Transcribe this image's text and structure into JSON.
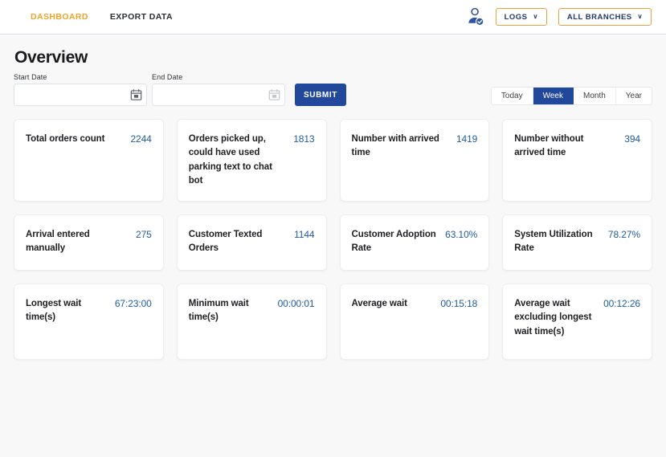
{
  "topbar": {
    "nav": [
      {
        "label": "DASHBOARD",
        "active": true
      },
      {
        "label": "EXPORT DATA",
        "active": false
      }
    ],
    "user_icon": "verified-user-icon",
    "logs_button": "LOGS",
    "branches_button": "ALL BRANCHES",
    "caret": "∨"
  },
  "overview": {
    "title": "Overview",
    "start_date_label": "Start Date",
    "end_date_label": "End Date",
    "start_date_value": "",
    "end_date_value": "",
    "start_date_placeholder": "",
    "end_date_placeholder": "",
    "submit_label": "SUBMIT",
    "calendar_icon": "calendar-icon"
  },
  "period": {
    "options": [
      {
        "label": "Today",
        "active": false
      },
      {
        "label": "Week",
        "active": true
      },
      {
        "label": "Month",
        "active": false
      },
      {
        "label": "Year",
        "active": false
      }
    ]
  },
  "cards": [
    {
      "label": "Total orders count",
      "value": "2244"
    },
    {
      "label": "Orders picked up, could have used parking text to chat bot",
      "value": "1813"
    },
    {
      "label": "Number with arrived time",
      "value": "1419"
    },
    {
      "label": "Number without arrived time",
      "value": "394"
    },
    {
      "label": "Arrival entered manually",
      "value": "275"
    },
    {
      "label": "Customer Texted Orders",
      "value": "1144"
    },
    {
      "label": "Customer Adoption Rate",
      "value": "63.10%"
    },
    {
      "label": "System Utilization Rate",
      "value": "78.27%"
    },
    {
      "label": "Longest wait time(s)",
      "value": "67:23:00"
    },
    {
      "label": "Minimum wait time(s)",
      "value": "00:00:01"
    },
    {
      "label": "Average wait",
      "value": "00:15:18"
    },
    {
      "label": "Average wait excluding longest wait time(s)",
      "value": "00:12:26"
    }
  ],
  "colors": {
    "accent_orange": "#f0a42a",
    "primary_blue": "#22489c",
    "value_blue": "#1f5c9e",
    "page_background": "#f8f8f9",
    "card_background": "#ffffff"
  }
}
